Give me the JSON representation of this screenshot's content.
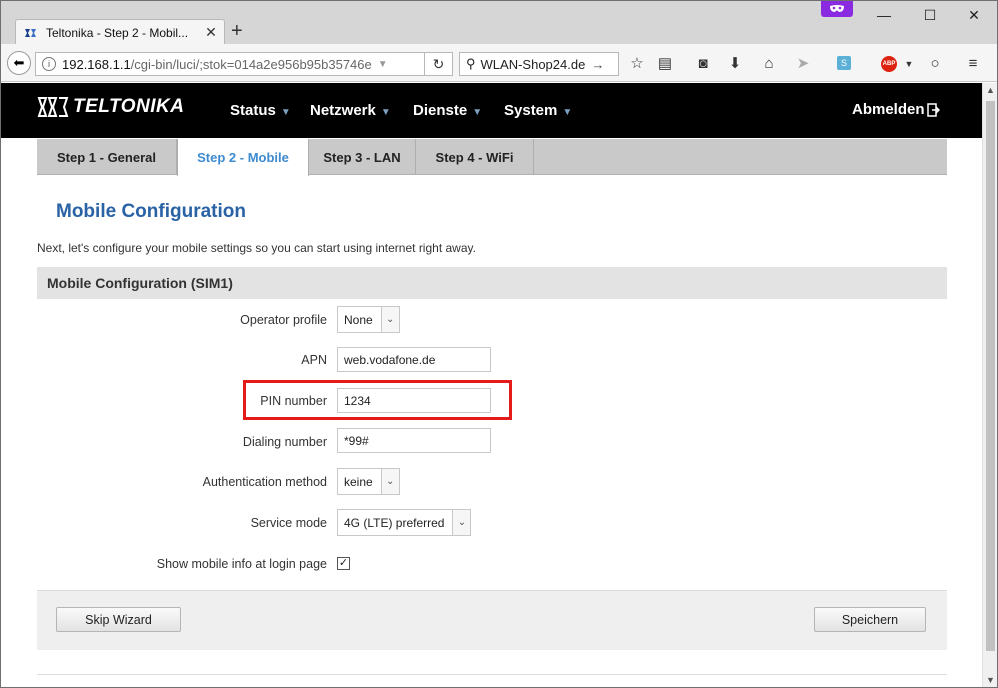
{
  "browser": {
    "tab_title": "Teltonika - Step 2 - Mobil...",
    "url_host": "192.168.1.1",
    "url_path": "/cgi-bin/luci/;stok=014a2e956b95b35746e",
    "search_text": "WLAN-Shop24.de"
  },
  "header": {
    "brand": "TELTONIKA",
    "menu": [
      "Status",
      "Netzwerk",
      "Dienste",
      "System"
    ],
    "logout_label": "Abmelden"
  },
  "steps": [
    "Step 1 - General",
    "Step 2 - Mobile",
    "Step 3 - LAN",
    "Step 4 - WiFi"
  ],
  "active_step": 1,
  "page": {
    "title": "Mobile Configuration",
    "intro": "Next, let's configure your mobile settings so you can start using internet right away.",
    "section_title": "Mobile Configuration (SIM1)"
  },
  "form": {
    "operator_profile": {
      "label": "Operator profile",
      "value": "None"
    },
    "apn": {
      "label": "APN",
      "value": "web.vodafone.de"
    },
    "pin": {
      "label": "PIN number",
      "value": "1234"
    },
    "dialing": {
      "label": "Dialing number",
      "value": "*99#"
    },
    "auth": {
      "label": "Authentication method",
      "value": "keine"
    },
    "service_mode": {
      "label": "Service mode",
      "value": "4G (LTE) preferred"
    },
    "show_info": {
      "label": "Show mobile info at login page",
      "checked": true
    }
  },
  "buttons": {
    "skip": "Skip Wizard",
    "save": "Speichern"
  },
  "colors": {
    "accent": "#2a62a6",
    "highlight": "#e31b1b",
    "header_bg": "#000000"
  }
}
